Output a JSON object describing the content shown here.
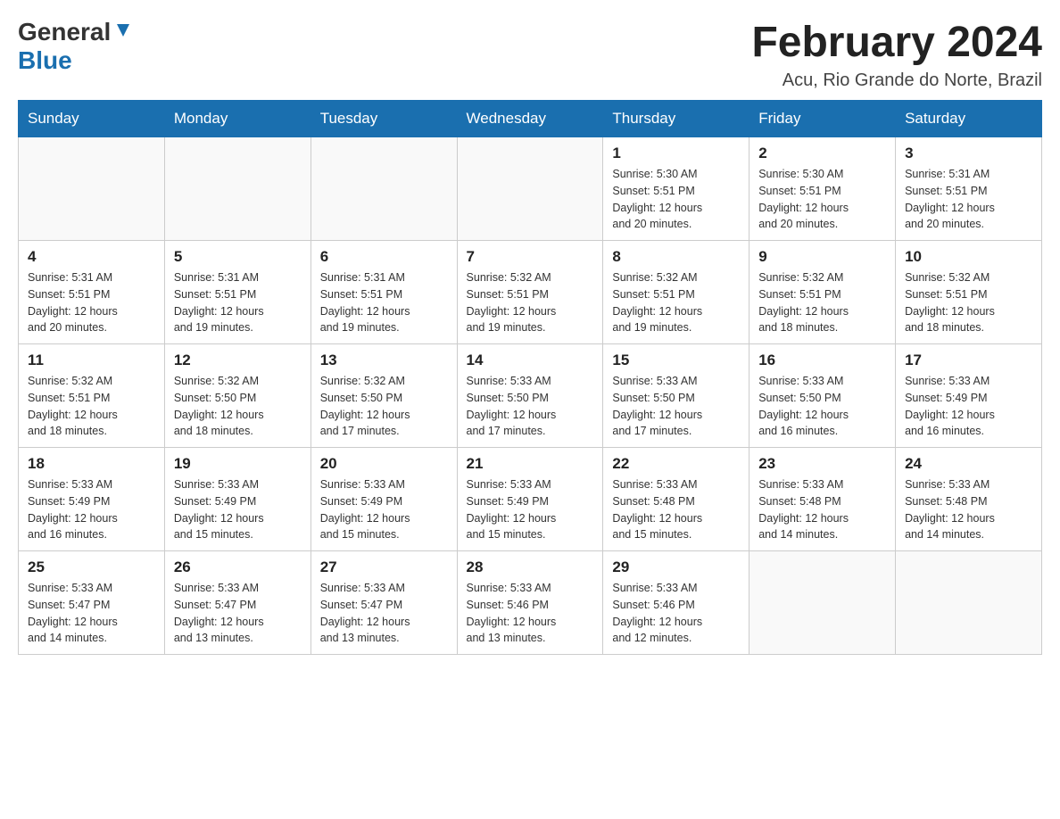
{
  "header": {
    "logo_general": "General",
    "logo_blue": "Blue",
    "title": "February 2024",
    "location": "Acu, Rio Grande do Norte, Brazil"
  },
  "calendar": {
    "days_of_week": [
      "Sunday",
      "Monday",
      "Tuesday",
      "Wednesday",
      "Thursday",
      "Friday",
      "Saturday"
    ],
    "weeks": [
      [
        {
          "day": "",
          "info": ""
        },
        {
          "day": "",
          "info": ""
        },
        {
          "day": "",
          "info": ""
        },
        {
          "day": "",
          "info": ""
        },
        {
          "day": "1",
          "info": "Sunrise: 5:30 AM\nSunset: 5:51 PM\nDaylight: 12 hours\nand 20 minutes."
        },
        {
          "day": "2",
          "info": "Sunrise: 5:30 AM\nSunset: 5:51 PM\nDaylight: 12 hours\nand 20 minutes."
        },
        {
          "day": "3",
          "info": "Sunrise: 5:31 AM\nSunset: 5:51 PM\nDaylight: 12 hours\nand 20 minutes."
        }
      ],
      [
        {
          "day": "4",
          "info": "Sunrise: 5:31 AM\nSunset: 5:51 PM\nDaylight: 12 hours\nand 20 minutes."
        },
        {
          "day": "5",
          "info": "Sunrise: 5:31 AM\nSunset: 5:51 PM\nDaylight: 12 hours\nand 19 minutes."
        },
        {
          "day": "6",
          "info": "Sunrise: 5:31 AM\nSunset: 5:51 PM\nDaylight: 12 hours\nand 19 minutes."
        },
        {
          "day": "7",
          "info": "Sunrise: 5:32 AM\nSunset: 5:51 PM\nDaylight: 12 hours\nand 19 minutes."
        },
        {
          "day": "8",
          "info": "Sunrise: 5:32 AM\nSunset: 5:51 PM\nDaylight: 12 hours\nand 19 minutes."
        },
        {
          "day": "9",
          "info": "Sunrise: 5:32 AM\nSunset: 5:51 PM\nDaylight: 12 hours\nand 18 minutes."
        },
        {
          "day": "10",
          "info": "Sunrise: 5:32 AM\nSunset: 5:51 PM\nDaylight: 12 hours\nand 18 minutes."
        }
      ],
      [
        {
          "day": "11",
          "info": "Sunrise: 5:32 AM\nSunset: 5:51 PM\nDaylight: 12 hours\nand 18 minutes."
        },
        {
          "day": "12",
          "info": "Sunrise: 5:32 AM\nSunset: 5:50 PM\nDaylight: 12 hours\nand 18 minutes."
        },
        {
          "day": "13",
          "info": "Sunrise: 5:32 AM\nSunset: 5:50 PM\nDaylight: 12 hours\nand 17 minutes."
        },
        {
          "day": "14",
          "info": "Sunrise: 5:33 AM\nSunset: 5:50 PM\nDaylight: 12 hours\nand 17 minutes."
        },
        {
          "day": "15",
          "info": "Sunrise: 5:33 AM\nSunset: 5:50 PM\nDaylight: 12 hours\nand 17 minutes."
        },
        {
          "day": "16",
          "info": "Sunrise: 5:33 AM\nSunset: 5:50 PM\nDaylight: 12 hours\nand 16 minutes."
        },
        {
          "day": "17",
          "info": "Sunrise: 5:33 AM\nSunset: 5:49 PM\nDaylight: 12 hours\nand 16 minutes."
        }
      ],
      [
        {
          "day": "18",
          "info": "Sunrise: 5:33 AM\nSunset: 5:49 PM\nDaylight: 12 hours\nand 16 minutes."
        },
        {
          "day": "19",
          "info": "Sunrise: 5:33 AM\nSunset: 5:49 PM\nDaylight: 12 hours\nand 15 minutes."
        },
        {
          "day": "20",
          "info": "Sunrise: 5:33 AM\nSunset: 5:49 PM\nDaylight: 12 hours\nand 15 minutes."
        },
        {
          "day": "21",
          "info": "Sunrise: 5:33 AM\nSunset: 5:49 PM\nDaylight: 12 hours\nand 15 minutes."
        },
        {
          "day": "22",
          "info": "Sunrise: 5:33 AM\nSunset: 5:48 PM\nDaylight: 12 hours\nand 15 minutes."
        },
        {
          "day": "23",
          "info": "Sunrise: 5:33 AM\nSunset: 5:48 PM\nDaylight: 12 hours\nand 14 minutes."
        },
        {
          "day": "24",
          "info": "Sunrise: 5:33 AM\nSunset: 5:48 PM\nDaylight: 12 hours\nand 14 minutes."
        }
      ],
      [
        {
          "day": "25",
          "info": "Sunrise: 5:33 AM\nSunset: 5:47 PM\nDaylight: 12 hours\nand 14 minutes."
        },
        {
          "day": "26",
          "info": "Sunrise: 5:33 AM\nSunset: 5:47 PM\nDaylight: 12 hours\nand 13 minutes."
        },
        {
          "day": "27",
          "info": "Sunrise: 5:33 AM\nSunset: 5:47 PM\nDaylight: 12 hours\nand 13 minutes."
        },
        {
          "day": "28",
          "info": "Sunrise: 5:33 AM\nSunset: 5:46 PM\nDaylight: 12 hours\nand 13 minutes."
        },
        {
          "day": "29",
          "info": "Sunrise: 5:33 AM\nSunset: 5:46 PM\nDaylight: 12 hours\nand 12 minutes."
        },
        {
          "day": "",
          "info": ""
        },
        {
          "day": "",
          "info": ""
        }
      ]
    ]
  }
}
